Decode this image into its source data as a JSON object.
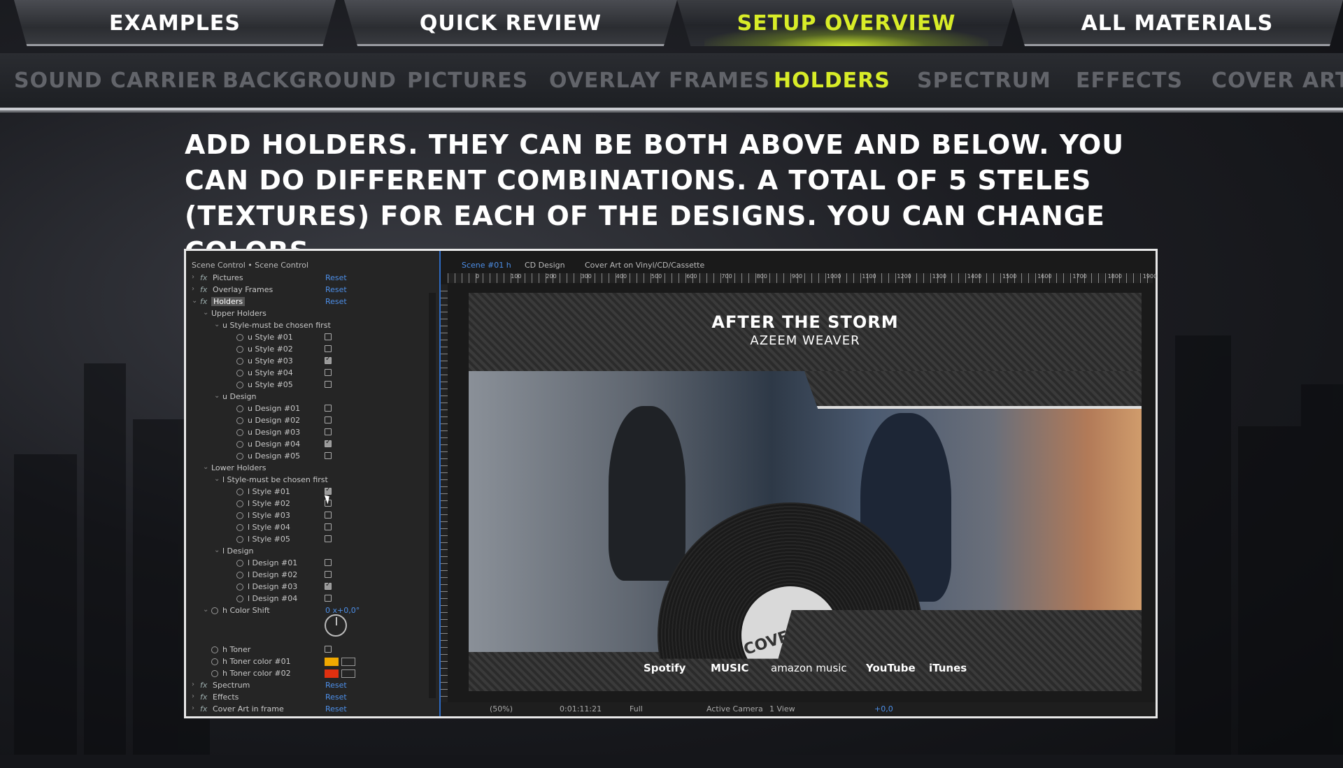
{
  "top_tabs": [
    {
      "label": "EXAMPLES"
    },
    {
      "label": "QUICK REVIEW"
    },
    {
      "label": "SETUP OVERVIEW"
    },
    {
      "label": "ALL MATERIALS"
    }
  ],
  "sub_nav": [
    {
      "label": "SOUND CARRIER"
    },
    {
      "label": "BACKGROUND"
    },
    {
      "label": "PICTURES"
    },
    {
      "label": "OVERLAY FRAMES"
    },
    {
      "label": "HOLDERS"
    },
    {
      "label": "SPECTRUM"
    },
    {
      "label": "EFFECTS"
    },
    {
      "label": "COVER ART"
    }
  ],
  "headline": "ADD HOLDERS. THEY CAN BE BOTH ABOVE AND BELOW. YOU CAN DO DIFFERENT COMBINATIONS. A TOTAL OF 5 STELES (TEXTURES) FOR EACH OF THE DESIGNS. YOU CAN CHANGE COLORS.",
  "panel": {
    "title": "Scene Control • Scene Control",
    "reset": "Reset",
    "fx": "fx",
    "effects": [
      "Pictures",
      "Overlay Frames",
      "Holders",
      "Spectrum",
      "Effects",
      "Cover Art in frame"
    ],
    "upper_holders": "Upper Holders",
    "u_style_group": "u Style-must be chosen first",
    "u_styles": [
      {
        "label": "u Style #01",
        "checked": false
      },
      {
        "label": "u Style #02",
        "checked": false
      },
      {
        "label": "u Style #03",
        "checked": true
      },
      {
        "label": "u Style #04",
        "checked": false
      },
      {
        "label": "u Style #05",
        "checked": false
      }
    ],
    "u_design_group": "u Design",
    "u_designs": [
      {
        "label": "u Design #01",
        "checked": false
      },
      {
        "label": "u Design #02",
        "checked": false
      },
      {
        "label": "u Design #03",
        "checked": false
      },
      {
        "label": "u Design #04",
        "checked": true
      },
      {
        "label": "u Design #05",
        "checked": false
      }
    ],
    "lower_holders": "Lower Holders",
    "l_style_group": "l Style-must be chosen first",
    "l_styles": [
      {
        "label": "l Style #01",
        "checked": true
      },
      {
        "label": "l Style #02",
        "checked": false
      },
      {
        "label": "l Style #03",
        "checked": false
      },
      {
        "label": "l Style #04",
        "checked": false
      },
      {
        "label": "l Style #05",
        "checked": false
      }
    ],
    "l_design_group": "l Design",
    "l_designs": [
      {
        "label": "l Design #01",
        "checked": false
      },
      {
        "label": "l Design #02",
        "checked": false
      },
      {
        "label": "l Design #03",
        "checked": true
      },
      {
        "label": "l Design #04",
        "checked": false
      }
    ],
    "color_shift": {
      "label": "h Color Shift",
      "value": "0 x+0,0°"
    },
    "toner": {
      "label": "h Toner",
      "checked": false
    },
    "toner_color1": {
      "label": "h Toner color #01",
      "color": "#f0a800"
    },
    "toner_color2": {
      "label": "h Toner color #02",
      "color": "#e03010"
    }
  },
  "comp": {
    "tabs": [
      "Scene #01 h",
      "CD Design",
      "Cover Art on Vinyl/CD/Cassette"
    ],
    "ruler_labels": [
      "0",
      "100",
      "200",
      "300",
      "400",
      "500",
      "600",
      "700",
      "800",
      "900",
      "1000",
      "1100",
      "1200",
      "1300",
      "1400",
      "1500",
      "1600",
      "1700",
      "1800",
      "1900"
    ],
    "title": "AFTER THE STORM",
    "artist": "AZEEM WEAVER",
    "vinyl_label": "COVER ART",
    "streaming": [
      "Spotify",
      "MUSIC",
      "amazon music",
      "YouTube",
      "iTunes"
    ],
    "status": {
      "zoom": "(50%)",
      "time": "0:01:11:21",
      "quality": "Full",
      "camera": "Active Camera",
      "views": "1 View",
      "exposure": "+0,0"
    }
  },
  "colors": {
    "accent": "#d8ec28",
    "link_blue": "#4d8fe8",
    "frame_border": "#e8e8e8"
  }
}
